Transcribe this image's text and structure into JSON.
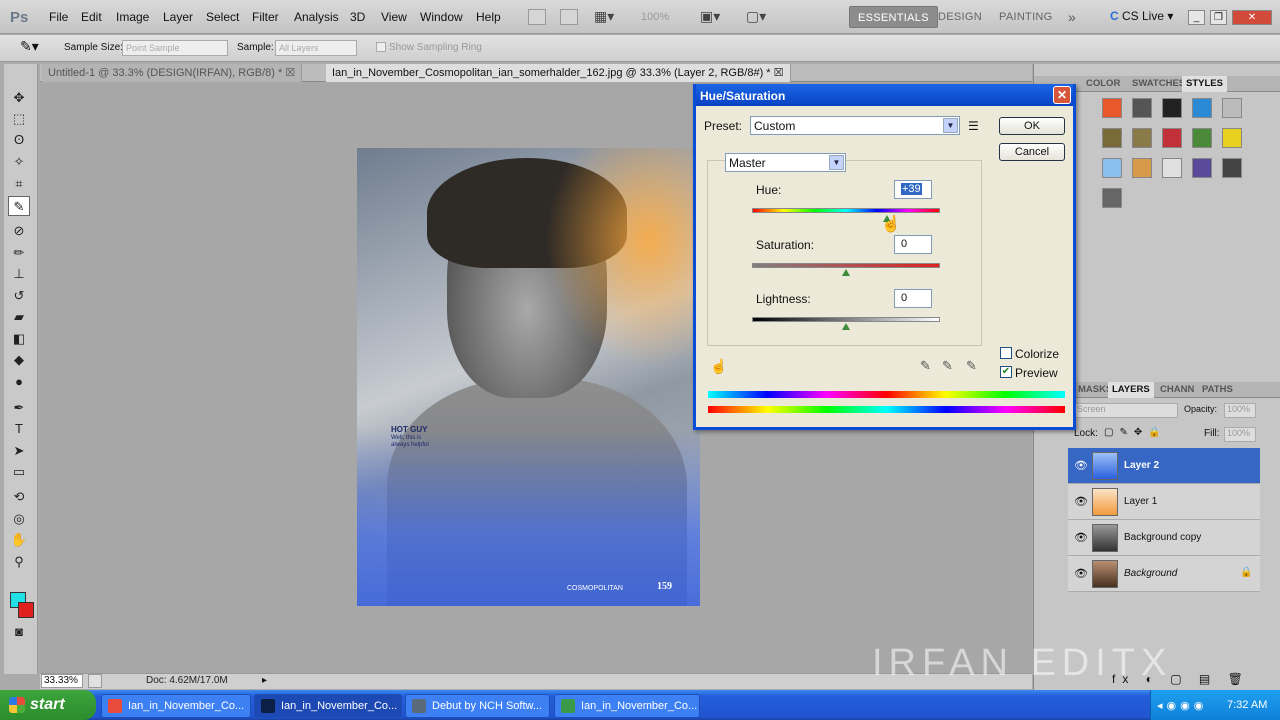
{
  "app": {
    "logo": "Ps"
  },
  "menu": [
    "File",
    "Edit",
    "Image",
    "Layer",
    "Select",
    "Filter",
    "Analysis",
    "3D",
    "View",
    "Window",
    "Help"
  ],
  "appbar": {
    "zoom": "100%"
  },
  "workspaces": {
    "essentials": "ESSENTIALS",
    "design": "DESIGN",
    "painting": "PAINTING",
    "more": "»"
  },
  "cslive": "CS Live",
  "options": {
    "sample_size_label": "Sample Size:",
    "sample_size_value": "Point Sample",
    "sample_label": "Sample:",
    "sample_value": "All Layers",
    "sampling_ring": "Show Sampling Ring"
  },
  "tabs": [
    {
      "label": "Untitled-1 @ 33.3% (DESIGN(IRFAN), RGB/8) *"
    },
    {
      "label": "Ian_in_November_Cosmopolitan_ian_somerhalder_162.jpg @ 33.3% (Layer 2, RGB/8#) *"
    }
  ],
  "magazine": {
    "hot": "HOT GUY",
    "sub": "Well, this is always helpful",
    "foot": "COSMOPOLITAN",
    "page": "159"
  },
  "status": {
    "zoom": "33.33%",
    "doc": "Doc: 4.62M/17.0M"
  },
  "dialog": {
    "title": "Hue/Saturation",
    "preset_label": "Preset:",
    "preset_value": "Custom",
    "channel": "Master",
    "hue_label": "Hue:",
    "hue_value": "+39",
    "hue_level": 0.72,
    "saturation_label": "Saturation:",
    "saturation_value": "0",
    "lightness_label": "Lightness:",
    "lightness_value": "0",
    "ok": "OK",
    "cancel": "Cancel",
    "colorize": "Colorize",
    "preview": "Preview",
    "preview_checked": true,
    "colorize_checked": false
  },
  "panels": {
    "top_tabs": [
      "COLOR",
      "SWATCHES",
      "STYLES"
    ],
    "layer_tabs": [
      "MASKS",
      "LAYERS",
      "CHANN",
      "PATHS"
    ],
    "blend": "Screen",
    "opacity_label": "Opacity:",
    "opacity_value": "100%",
    "lock_label": "Lock:",
    "fill_label": "Fill:",
    "fill_value": "100%",
    "layers": [
      {
        "name": "Layer 2",
        "selected": true
      },
      {
        "name": "Layer 1",
        "selected": false
      },
      {
        "name": "Background copy",
        "selected": false
      },
      {
        "name": "Background",
        "selected": false,
        "locked": true
      }
    ]
  },
  "taskbar": {
    "start": "start",
    "items": [
      {
        "label": "Ian_in_November_Co..."
      },
      {
        "label": "Ian_in_November_Co..."
      },
      {
        "label": "Debut by NCH Softw..."
      },
      {
        "label": "Ian_in_November_Co..."
      }
    ],
    "clock": "7:32 AM"
  },
  "watermark": "IRFAN EDITX",
  "colors": {
    "dialog_title": "#0842c4",
    "selected_layer": "#3667c4",
    "fg_swatch": "#21e0e6",
    "bg_swatch": "#e0201c"
  }
}
